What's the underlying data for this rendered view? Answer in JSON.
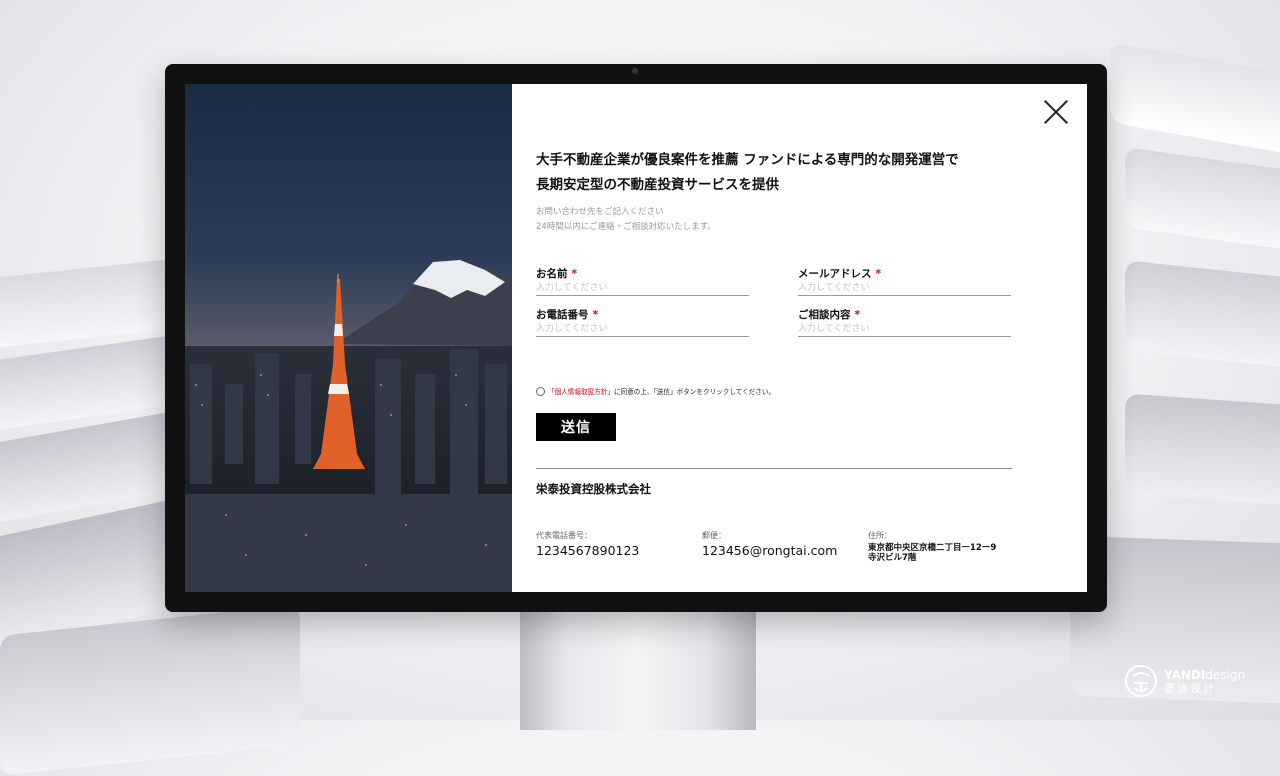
{
  "hero_image": {
    "alt": "Tokyo Tower and Mount Fuji at dusk"
  },
  "form": {
    "headline_lines": [
      "大手不動産企業が優良案件を推薦 ファンドによる専門的な開発運営で",
      "長期安定型の不動産投資サービスを提供"
    ],
    "subtext_lines": [
      "お問い合わせ先をご記入ください",
      "24時間以内にご連絡・ご相談対応いたします。"
    ],
    "fields": {
      "name": {
        "label": "お名前",
        "required_mark": "*",
        "placeholder": "入力してください",
        "value": ""
      },
      "email": {
        "label": "メールアドレス",
        "required_mark": "*",
        "placeholder": "入力してください",
        "value": ""
      },
      "phone": {
        "label": "お電話番号",
        "required_mark": "*",
        "placeholder": "入力してください",
        "value": ""
      },
      "inquiry": {
        "label": "ご相談内容",
        "required_mark": "*",
        "placeholder": "入力してください",
        "value": ""
      }
    },
    "consent": {
      "policy_text": "「個人情報取扱方針」",
      "rest_text": "に同意の上、「送信」ボタンをクリックしてください。"
    },
    "submit_label": "送信"
  },
  "company": {
    "name": "栄泰投資控股株式会社",
    "phone_label": "代表電話番号：",
    "phone_value": "1234567890123",
    "mail_label": "郵便：",
    "mail_value": "123456@rongtai.com",
    "address_label": "住所：",
    "address_lines": [
      "東京都中央区京橋二丁目ー12ー9",
      "寺沢ビル7階"
    ]
  },
  "watermark": {
    "brand_bold": "YANDI",
    "brand_rest": "design",
    "brand_cn": "晏迪设计"
  },
  "colors": {
    "accent_red": "#d0021b",
    "button_bg": "#000000",
    "panel_bg": "#ffffff"
  },
  "icons": [
    "close-icon",
    "radio-icon",
    "yandi-logo-icon"
  ]
}
